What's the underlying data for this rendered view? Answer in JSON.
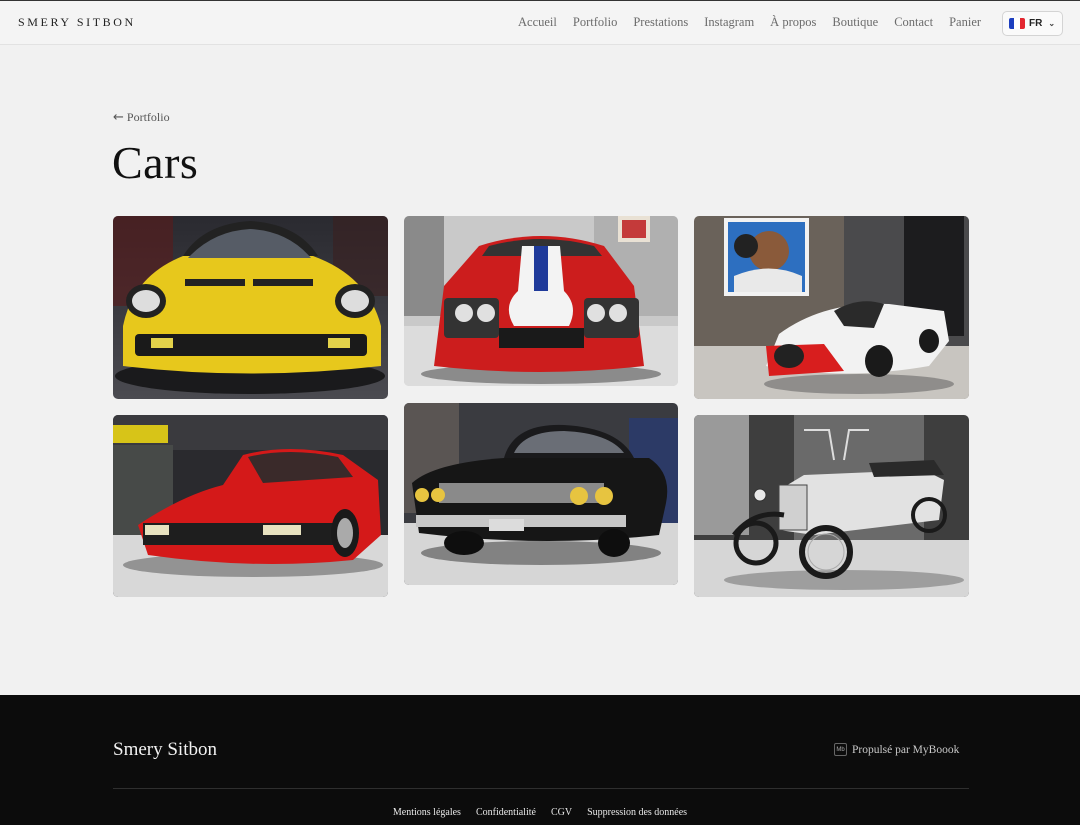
{
  "header": {
    "brand": "SMERY SITBON",
    "nav": [
      "Accueil",
      "Portfolio",
      "Prestations",
      "Instagram",
      "À propos",
      "Boutique",
      "Contact",
      "Panier"
    ],
    "language": {
      "code": "FR",
      "flag_colors": [
        "#1d3fbf",
        "#ffffff",
        "#e3262f"
      ]
    }
  },
  "main": {
    "back_label": "Portfolio",
    "title": "Cars",
    "photos": [
      {
        "subject": "yellow sports car"
      },
      {
        "subject": "red car with white stripe"
      },
      {
        "subject": "white and red race car with painting"
      },
      {
        "subject": "red sports car"
      },
      {
        "subject": "black classic car"
      },
      {
        "subject": "black and white vintage car"
      }
    ]
  },
  "footer": {
    "brand": "Smery Sitbon",
    "mb_badge": "Mb",
    "powered": "Propulsé par MyBoook",
    "links": [
      "Mentions légales",
      "Confidentialité",
      "CGV",
      "Suppression des données"
    ]
  }
}
